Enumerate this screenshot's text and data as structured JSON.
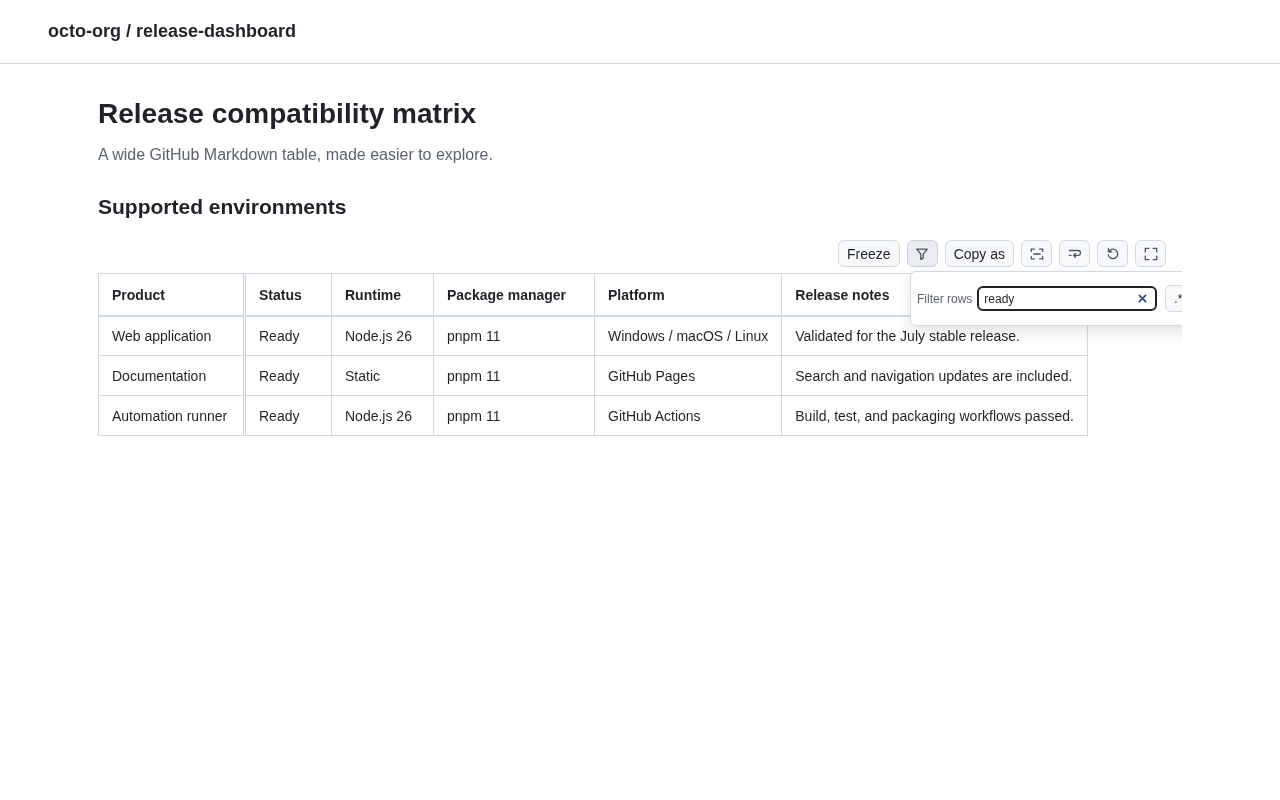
{
  "header": {
    "repo_path": "octo-org / release-dashboard"
  },
  "page": {
    "title": "Release compatibility matrix",
    "subtitle": "A wide GitHub Markdown table, made easier to explore."
  },
  "section": {
    "heading": "Supported environments"
  },
  "toolbar": {
    "buttons": [
      {
        "kind": "text",
        "label": "Freeze",
        "pressed": false
      },
      {
        "kind": "filter",
        "pressed": true
      },
      {
        "kind": "text",
        "label": "Copy as",
        "pressed": false
      },
      {
        "kind": "fit",
        "pressed": false
      },
      {
        "kind": "wrap",
        "pressed": false
      },
      {
        "kind": "reset",
        "pressed": false
      },
      {
        "kind": "fullscreen",
        "pressed": false
      }
    ]
  },
  "filter_popover": {
    "label": "Filter rows",
    "value": "ready",
    "regex_button": ".*"
  },
  "table": {
    "columns": [
      "Product",
      "Status",
      "Runtime",
      "Package manager",
      "Platform",
      "Release notes"
    ],
    "rows": [
      [
        "Web application",
        "Ready",
        "Node.js 26",
        "pnpm 11",
        "Windows / macOS / Linux",
        "Validated for the July stable release."
      ],
      [
        "Documentation",
        "Ready",
        "Static",
        "pnpm 11",
        "GitHub Pages",
        "Search and navigation updates are included."
      ],
      [
        "Automation runner",
        "Ready",
        "Node.js 26",
        "pnpm 11",
        "GitHub Actions",
        "Build, test, and packaging workflows passed."
      ]
    ]
  }
}
